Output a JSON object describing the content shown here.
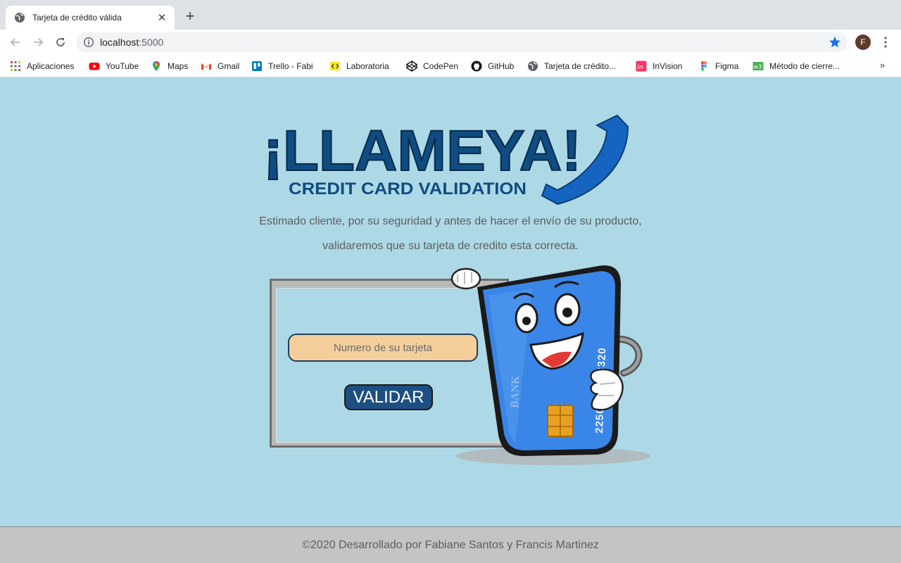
{
  "browser": {
    "tab_title": "Tarjeta de crédito válida",
    "url_host": "localhost",
    "url_port": ":5000",
    "profile_initial": "F",
    "bookmarks": [
      {
        "label": "Aplicaciones",
        "icon": "apps-grid-icon"
      },
      {
        "label": "YouTube",
        "icon": "youtube-icon"
      },
      {
        "label": "Maps",
        "icon": "maps-pin-icon"
      },
      {
        "label": "Gmail",
        "icon": "gmail-icon"
      },
      {
        "label": "Trello - Fabi",
        "icon": "trello-icon"
      },
      {
        "label": "Laboratoria",
        "icon": "laboratoria-icon"
      },
      {
        "label": "CodePen",
        "icon": "codepen-icon"
      },
      {
        "label": "GitHub",
        "icon": "github-icon"
      },
      {
        "label": "Tarjeta de crédito...",
        "icon": "globe-icon"
      },
      {
        "label": "InVision",
        "icon": "invision-icon"
      },
      {
        "label": "Figma",
        "icon": "figma-icon"
      },
      {
        "label": "Método de cierre...",
        "icon": "w3-icon"
      }
    ],
    "more_bookmarks": "»"
  },
  "logo": {
    "title": "¡LLAMEYA!",
    "subtitle": "CREDIT CARD VALIDATION"
  },
  "intro": {
    "line1": "Estimado cliente, por su seguridad y antes de hacer el envío de su producto,",
    "line2": "validaremos que su tarjeta de credito esta correcta."
  },
  "form": {
    "card_placeholder": "Numero de su tarjeta",
    "card_value": "",
    "submit_label": "VALIDAR"
  },
  "mascot": {
    "card_number": "2250 5537 3320",
    "bank_label": "BANK"
  },
  "footer": {
    "text": "©2020 Desarrollado por Fabiane Santos y Francis Martinez"
  },
  "colors": {
    "page_bg": "#add8e6",
    "logo_blue": "#0f4c81",
    "input_bg": "#f5cf9b",
    "button_bg": "#1d4f83",
    "footer_bg": "#c4c4c4"
  }
}
